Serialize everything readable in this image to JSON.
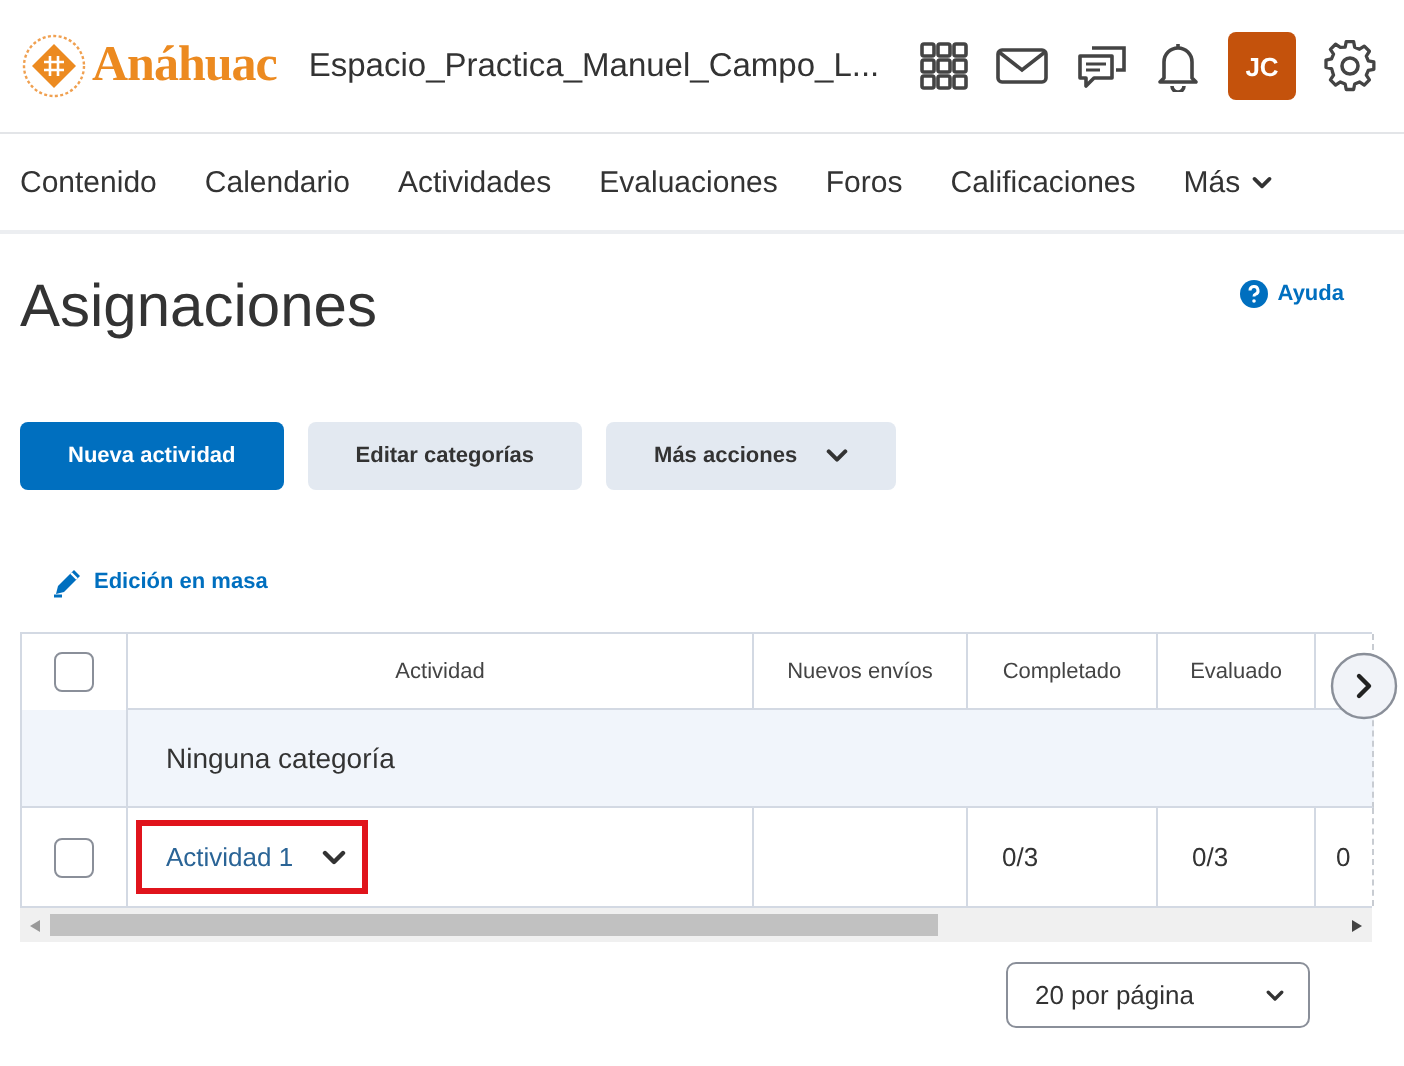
{
  "header": {
    "logo": "Anáhuac",
    "course_title": "Espacio_Practica_Manuel_Campo_L...",
    "avatar": "JC"
  },
  "nav": [
    {
      "label": "Contenido"
    },
    {
      "label": "Calendario"
    },
    {
      "label": "Actividades"
    },
    {
      "label": "Evaluaciones"
    },
    {
      "label": "Foros"
    },
    {
      "label": "Calificaciones"
    },
    {
      "label": "Más",
      "kind": "menu"
    }
  ],
  "page": {
    "title": "Asignaciones",
    "help": "Ayuda"
  },
  "actions": [
    {
      "label": "Nueva actividad",
      "kind": "primary"
    },
    {
      "label": "Editar categorías",
      "kind": "secondary"
    },
    {
      "label": "Más acciones",
      "kind": "menu"
    }
  ],
  "bulk_edit": "Edición en masa",
  "table": {
    "select_all": {
      "checked": false
    },
    "columns": [
      "Actividad",
      "Nuevos envíos",
      "Completado",
      "Evaluado"
    ],
    "category": "Ninguna categoría",
    "rows": [
      {
        "checked": false,
        "highlighted": true,
        "cells": [
          "Actividad 1",
          "",
          "0/3",
          "0/3",
          "0"
        ]
      }
    ]
  },
  "pager": {
    "value": "20 por página"
  }
}
